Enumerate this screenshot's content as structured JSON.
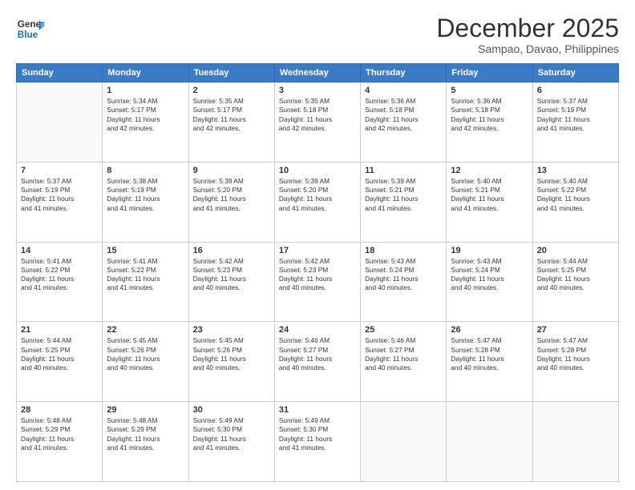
{
  "header": {
    "logo_line1": "General",
    "logo_line2": "Blue",
    "month": "December 2025",
    "location": "Sampao, Davao, Philippines"
  },
  "calendar": {
    "weekdays": [
      "Sunday",
      "Monday",
      "Tuesday",
      "Wednesday",
      "Thursday",
      "Friday",
      "Saturday"
    ],
    "weeks": [
      [
        {
          "day": "",
          "detail": ""
        },
        {
          "day": "1",
          "detail": "Sunrise: 5:34 AM\nSunset: 5:17 PM\nDaylight: 11 hours\nand 42 minutes."
        },
        {
          "day": "2",
          "detail": "Sunrise: 5:35 AM\nSunset: 5:17 PM\nDaylight: 11 hours\nand 42 minutes."
        },
        {
          "day": "3",
          "detail": "Sunrise: 5:35 AM\nSunset: 5:18 PM\nDaylight: 11 hours\nand 42 minutes."
        },
        {
          "day": "4",
          "detail": "Sunrise: 5:36 AM\nSunset: 5:18 PM\nDaylight: 11 hours\nand 42 minutes."
        },
        {
          "day": "5",
          "detail": "Sunrise: 5:36 AM\nSunset: 5:18 PM\nDaylight: 11 hours\nand 42 minutes."
        },
        {
          "day": "6",
          "detail": "Sunrise: 5:37 AM\nSunset: 5:19 PM\nDaylight: 11 hours\nand 41 minutes."
        }
      ],
      [
        {
          "day": "7",
          "detail": "Sunrise: 5:37 AM\nSunset: 5:19 PM\nDaylight: 11 hours\nand 41 minutes."
        },
        {
          "day": "8",
          "detail": "Sunrise: 5:38 AM\nSunset: 5:19 PM\nDaylight: 11 hours\nand 41 minutes."
        },
        {
          "day": "9",
          "detail": "Sunrise: 5:38 AM\nSunset: 5:20 PM\nDaylight: 11 hours\nand 41 minutes."
        },
        {
          "day": "10",
          "detail": "Sunrise: 5:39 AM\nSunset: 5:20 PM\nDaylight: 11 hours\nand 41 minutes."
        },
        {
          "day": "11",
          "detail": "Sunrise: 5:39 AM\nSunset: 5:21 PM\nDaylight: 11 hours\nand 41 minutes."
        },
        {
          "day": "12",
          "detail": "Sunrise: 5:40 AM\nSunset: 5:21 PM\nDaylight: 11 hours\nand 41 minutes."
        },
        {
          "day": "13",
          "detail": "Sunrise: 5:40 AM\nSunset: 5:22 PM\nDaylight: 11 hours\nand 41 minutes."
        }
      ],
      [
        {
          "day": "14",
          "detail": "Sunrise: 5:41 AM\nSunset: 5:22 PM\nDaylight: 11 hours\nand 41 minutes."
        },
        {
          "day": "15",
          "detail": "Sunrise: 5:41 AM\nSunset: 5:22 PM\nDaylight: 11 hours\nand 41 minutes."
        },
        {
          "day": "16",
          "detail": "Sunrise: 5:42 AM\nSunset: 5:23 PM\nDaylight: 11 hours\nand 40 minutes."
        },
        {
          "day": "17",
          "detail": "Sunrise: 5:42 AM\nSunset: 5:23 PM\nDaylight: 11 hours\nand 40 minutes."
        },
        {
          "day": "18",
          "detail": "Sunrise: 5:43 AM\nSunset: 5:24 PM\nDaylight: 11 hours\nand 40 minutes."
        },
        {
          "day": "19",
          "detail": "Sunrise: 5:43 AM\nSunset: 5:24 PM\nDaylight: 11 hours\nand 40 minutes."
        },
        {
          "day": "20",
          "detail": "Sunrise: 5:44 AM\nSunset: 5:25 PM\nDaylight: 11 hours\nand 40 minutes."
        }
      ],
      [
        {
          "day": "21",
          "detail": "Sunrise: 5:44 AM\nSunset: 5:25 PM\nDaylight: 11 hours\nand 40 minutes."
        },
        {
          "day": "22",
          "detail": "Sunrise: 5:45 AM\nSunset: 5:26 PM\nDaylight: 11 hours\nand 40 minutes."
        },
        {
          "day": "23",
          "detail": "Sunrise: 5:45 AM\nSunset: 5:26 PM\nDaylight: 11 hours\nand 40 minutes."
        },
        {
          "day": "24",
          "detail": "Sunrise: 5:46 AM\nSunset: 5:27 PM\nDaylight: 11 hours\nand 40 minutes."
        },
        {
          "day": "25",
          "detail": "Sunrise: 5:46 AM\nSunset: 5:27 PM\nDaylight: 11 hours\nand 40 minutes."
        },
        {
          "day": "26",
          "detail": "Sunrise: 5:47 AM\nSunset: 5:28 PM\nDaylight: 11 hours\nand 40 minutes."
        },
        {
          "day": "27",
          "detail": "Sunrise: 5:47 AM\nSunset: 5:28 PM\nDaylight: 11 hours\nand 40 minutes."
        }
      ],
      [
        {
          "day": "28",
          "detail": "Sunrise: 5:48 AM\nSunset: 5:29 PM\nDaylight: 11 hours\nand 41 minutes."
        },
        {
          "day": "29",
          "detail": "Sunrise: 5:48 AM\nSunset: 5:29 PM\nDaylight: 11 hours\nand 41 minutes."
        },
        {
          "day": "30",
          "detail": "Sunrise: 5:49 AM\nSunset: 5:30 PM\nDaylight: 11 hours\nand 41 minutes."
        },
        {
          "day": "31",
          "detail": "Sunrise: 5:49 AM\nSunset: 5:30 PM\nDaylight: 11 hours\nand 41 minutes."
        },
        {
          "day": "",
          "detail": ""
        },
        {
          "day": "",
          "detail": ""
        },
        {
          "day": "",
          "detail": ""
        }
      ]
    ]
  }
}
